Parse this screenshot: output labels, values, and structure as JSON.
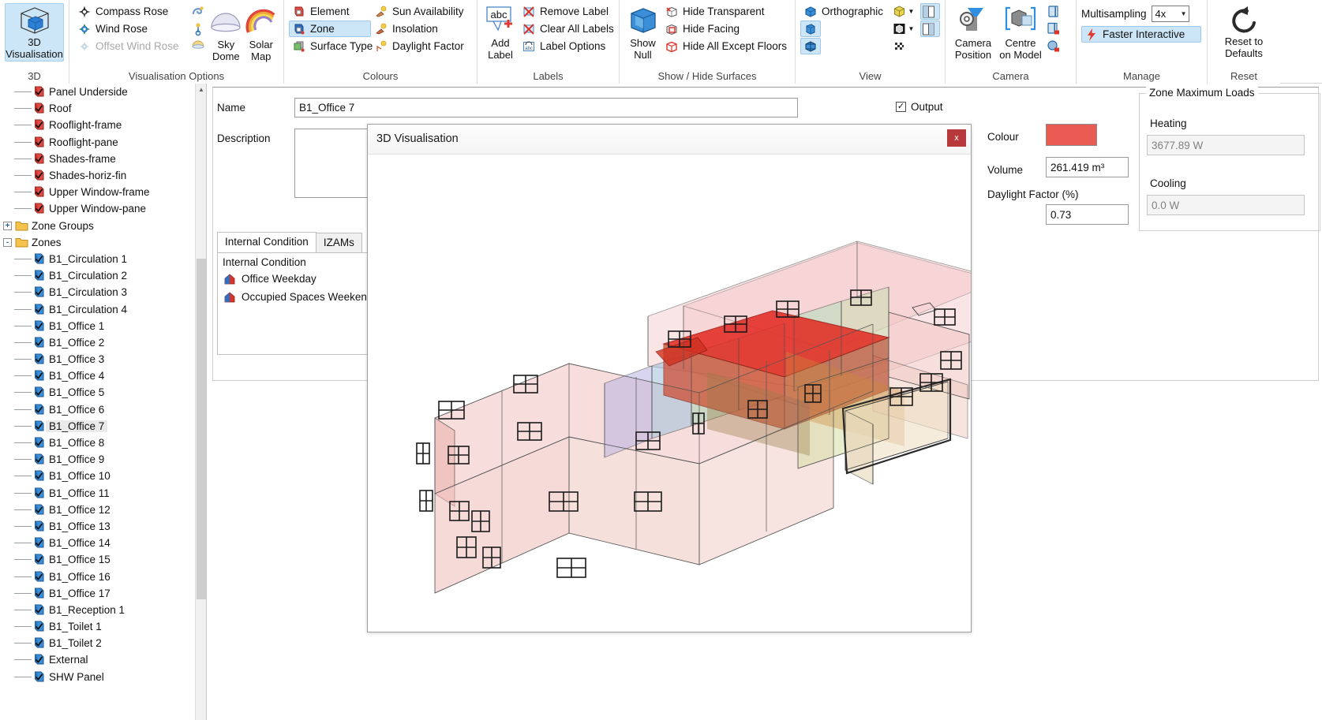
{
  "ribbon": {
    "groups": [
      {
        "caption": "3D",
        "big": {
          "label_line1": "3D",
          "label_line2": "Visualisation",
          "icon": "cube-wireframe-icon",
          "selected": true
        }
      },
      {
        "caption": "Visualisation Options",
        "items": [
          {
            "label": "Compass Rose",
            "icon": "compass-rose-icon",
            "disabled": false
          },
          {
            "label": "Wind Rose",
            "icon": "wind-rose-icon",
            "disabled": false
          },
          {
            "label": "Offset Wind Rose",
            "icon": "offset-wind-rose-icon",
            "disabled": true
          }
        ],
        "icons_column": [
          "wind-swirl-icon",
          "wind-barb-icon",
          "half-dome-icon"
        ],
        "big_buttons": [
          {
            "label_line1": "Sky",
            "label_line2": "Dome",
            "icon": "sky-dome-icon"
          },
          {
            "label_line1": "Solar",
            "label_line2": "Map",
            "icon": "solar-map-icon"
          }
        ]
      },
      {
        "caption": "Colours",
        "col1": [
          {
            "label": "Element",
            "icon": "element-colour-icon",
            "selected": false
          },
          {
            "label": "Zone",
            "icon": "zone-colour-icon",
            "selected": true
          },
          {
            "label": "Surface Type",
            "icon": "surface-type-icon",
            "selected": false
          }
        ],
        "col2": [
          {
            "label": "Sun Availability",
            "icon": "sun-availability-icon"
          },
          {
            "label": "Insolation",
            "icon": "insolation-icon"
          },
          {
            "label": "Daylight Factor",
            "icon": "daylight-factor-icon"
          }
        ]
      },
      {
        "caption": "Labels",
        "big": {
          "label_line1": "Add",
          "label_line2": "Label",
          "icon": "add-label-icon"
        },
        "items": [
          {
            "label": "Remove Label",
            "icon": "remove-label-icon"
          },
          {
            "label": "Clear All Labels",
            "icon": "clear-all-labels-icon"
          },
          {
            "label": "Label Options",
            "icon": "label-options-icon"
          }
        ]
      },
      {
        "caption": "Show / Hide Surfaces",
        "big": {
          "label_line1": "Show",
          "label_line2": "Null",
          "icon": "show-null-icon"
        },
        "items": [
          {
            "label": "Hide Transparent",
            "icon": "hide-transparent-icon"
          },
          {
            "label": "Hide Facing",
            "icon": "hide-facing-icon"
          },
          {
            "label": "Hide All Except Floors",
            "icon": "hide-all-except-floors-icon"
          }
        ]
      },
      {
        "caption": "View",
        "items": [
          {
            "label": "Orthographic",
            "icon": "orthographic-icon",
            "selected": false
          },
          {
            "label": "",
            "icon": "perspective-solid-icon",
            "selected": true
          },
          {
            "label": "",
            "icon": "wireframe-icon",
            "selected": true
          }
        ],
        "mid_icons": [
          {
            "icon": "yellow-cube-icon",
            "has_caret": true
          },
          {
            "icon": "dark-cube-icon",
            "has_caret": true
          },
          {
            "icon": "checker-icon",
            "has_caret": false
          }
        ],
        "right_icons": [
          {
            "icon": "split-view-left-icon",
            "selected": true
          },
          {
            "icon": "split-view-right-icon",
            "selected": true
          }
        ]
      },
      {
        "caption": "Camera",
        "big_buttons": [
          {
            "label_line1": "Camera",
            "label_line2": "Position",
            "icon": "camera-position-icon"
          },
          {
            "label_line1": "Centre",
            "label_line2": "on Model",
            "icon": "centre-on-model-icon"
          }
        ],
        "small_icons": [
          {
            "icon": "save-view-icon"
          },
          {
            "icon": "lock-view-icon"
          },
          {
            "icon": "reset-rotation-icon"
          }
        ]
      },
      {
        "caption": "Manage",
        "multisampling_label": "Multisampling",
        "multisampling_value": "4x",
        "faster_interactive": {
          "label": "Faster Interactive",
          "icon": "lightning-icon",
          "selected": true
        }
      },
      {
        "caption": "Reset",
        "big": {
          "label_line1": "Reset to",
          "label_line2": "Defaults",
          "icon": "reset-arrow-icon"
        }
      }
    ]
  },
  "tree": {
    "items": [
      {
        "label": "Panel Underside",
        "icon": "construction-icon",
        "depth": 2,
        "type": "leaf"
      },
      {
        "label": "Roof",
        "icon": "construction-icon",
        "depth": 2,
        "type": "leaf"
      },
      {
        "label": "Rooflight-frame",
        "icon": "construction-icon",
        "depth": 2,
        "type": "leaf"
      },
      {
        "label": "Rooflight-pane",
        "icon": "construction-icon",
        "depth": 2,
        "type": "leaf"
      },
      {
        "label": "Shades-frame",
        "icon": "construction-icon",
        "depth": 2,
        "type": "leaf"
      },
      {
        "label": "Shades-horiz-fin",
        "icon": "construction-icon",
        "depth": 2,
        "type": "leaf"
      },
      {
        "label": "Upper Window-frame",
        "icon": "construction-icon",
        "depth": 2,
        "type": "leaf"
      },
      {
        "label": "Upper Window-pane",
        "icon": "construction-icon",
        "depth": 2,
        "type": "leaf"
      },
      {
        "label": "Zone Groups",
        "icon": "folder-icon",
        "depth": 1,
        "type": "folder",
        "expander": "+"
      },
      {
        "label": "Zones",
        "icon": "folder-icon",
        "depth": 1,
        "type": "folder",
        "expander": "-"
      },
      {
        "label": "B1_Circulation 1",
        "icon": "zone-icon",
        "depth": 2,
        "type": "leaf"
      },
      {
        "label": "B1_Circulation 2",
        "icon": "zone-icon",
        "depth": 2,
        "type": "leaf"
      },
      {
        "label": "B1_Circulation 3",
        "icon": "zone-icon",
        "depth": 2,
        "type": "leaf"
      },
      {
        "label": "B1_Circulation 4",
        "icon": "zone-icon",
        "depth": 2,
        "type": "leaf"
      },
      {
        "label": "B1_Office 1",
        "icon": "zone-icon",
        "depth": 2,
        "type": "leaf"
      },
      {
        "label": "B1_Office 2",
        "icon": "zone-icon",
        "depth": 2,
        "type": "leaf"
      },
      {
        "label": "B1_Office 3",
        "icon": "zone-icon",
        "depth": 2,
        "type": "leaf"
      },
      {
        "label": "B1_Office 4",
        "icon": "zone-icon",
        "depth": 2,
        "type": "leaf"
      },
      {
        "label": "B1_Office 5",
        "icon": "zone-icon",
        "depth": 2,
        "type": "leaf"
      },
      {
        "label": "B1_Office 6",
        "icon": "zone-icon",
        "depth": 2,
        "type": "leaf"
      },
      {
        "label": "B1_Office 7",
        "icon": "zone-icon",
        "depth": 2,
        "type": "leaf",
        "selected": true
      },
      {
        "label": "B1_Office 8",
        "icon": "zone-icon",
        "depth": 2,
        "type": "leaf"
      },
      {
        "label": "B1_Office 9",
        "icon": "zone-icon",
        "depth": 2,
        "type": "leaf"
      },
      {
        "label": "B1_Office 10",
        "icon": "zone-icon",
        "depth": 2,
        "type": "leaf"
      },
      {
        "label": "B1_Office 11",
        "icon": "zone-icon",
        "depth": 2,
        "type": "leaf"
      },
      {
        "label": "B1_Office 12",
        "icon": "zone-icon",
        "depth": 2,
        "type": "leaf"
      },
      {
        "label": "B1_Office 13",
        "icon": "zone-icon",
        "depth": 2,
        "type": "leaf"
      },
      {
        "label": "B1_Office 14",
        "icon": "zone-icon",
        "depth": 2,
        "type": "leaf"
      },
      {
        "label": "B1_Office 15",
        "icon": "zone-icon",
        "depth": 2,
        "type": "leaf"
      },
      {
        "label": "B1_Office 16",
        "icon": "zone-icon",
        "depth": 2,
        "type": "leaf"
      },
      {
        "label": "B1_Office 17",
        "icon": "zone-icon",
        "depth": 2,
        "type": "leaf"
      },
      {
        "label": "B1_Reception 1",
        "icon": "zone-icon",
        "depth": 2,
        "type": "leaf"
      },
      {
        "label": "B1_Toilet 1",
        "icon": "zone-icon",
        "depth": 2,
        "type": "leaf"
      },
      {
        "label": "B1_Toilet 2",
        "icon": "zone-icon",
        "depth": 2,
        "type": "leaf"
      },
      {
        "label": "External",
        "icon": "zone-icon",
        "depth": 2,
        "type": "leaf"
      },
      {
        "label": "SHW Panel",
        "icon": "zone-icon",
        "depth": 2,
        "type": "leaf"
      }
    ]
  },
  "form": {
    "name_label": "Name",
    "name_value": "B1_Office 7",
    "description_label": "Description",
    "description_value": "",
    "output_label": "Output",
    "output_checked": true,
    "colour_label": "Colour",
    "colour_value": "#e85a52",
    "volume_label": "Volume",
    "volume_value": "261.419 m³",
    "daylight_label": "Daylight Factor (%)",
    "daylight_value": "0.73",
    "zone_max_loads_title": "Zone Maximum Loads",
    "heating_label": "Heating",
    "heating_value": "3677.89 W",
    "cooling_label": "Cooling",
    "cooling_value": "0.0 W",
    "tabs": [
      {
        "label": "Internal Condition",
        "active": true
      },
      {
        "label": "IZAMs",
        "active": false
      }
    ],
    "internal_condition_header": "Internal Condition",
    "internal_condition_items": [
      {
        "label": "Office Weekday",
        "icon": "profile-icon"
      },
      {
        "label": "Occupied Spaces Weekend",
        "icon": "profile-icon"
      }
    ]
  },
  "dialog": {
    "title": "3D Visualisation",
    "close_label": "x",
    "close_color": "#b8393b",
    "model_description": "Transparent shaded 3D building model showing zone-coloured rooms; one zone highlighted in red"
  }
}
